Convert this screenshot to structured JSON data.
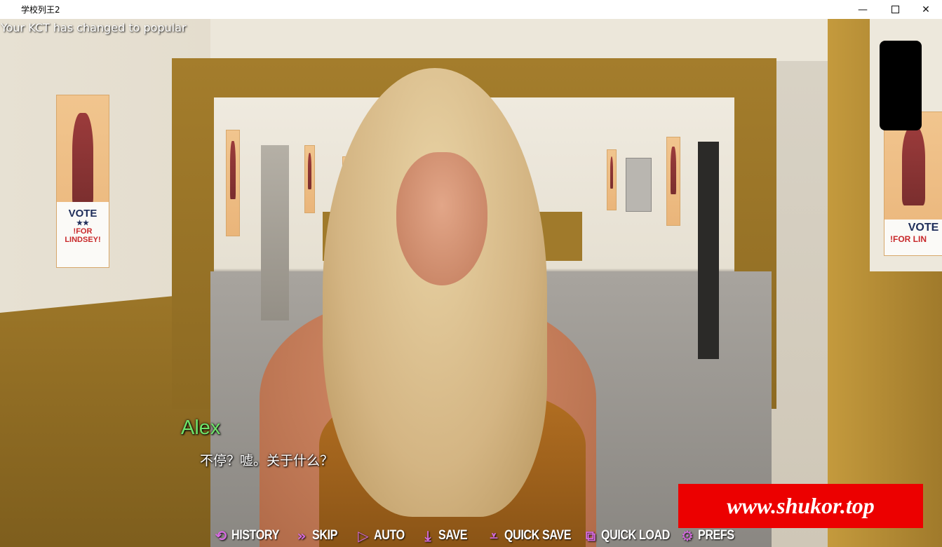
{
  "window": {
    "title": "学校列王2",
    "minimize_glyph": "—",
    "close_glyph": "✕"
  },
  "notification": "Your KCT has changed to popular",
  "posters": {
    "vote_text": "VOTE",
    "stars": "★★",
    "candidate_text": "!FOR LINDSEY!",
    "right_candidate_text": "!FOR LIN"
  },
  "dialogue": {
    "speaker": "Alex",
    "text": "不停？嘘。关于什么？",
    "speaker_color": "#6fe36a"
  },
  "watermark": "www.shukor.top",
  "quick_menu": {
    "icon_color": "#d56be0",
    "items": [
      {
        "label": "HISTORY",
        "icon": "history-icon",
        "glyph": "⟲"
      },
      {
        "label": "SKIP",
        "icon": "skip-icon",
        "glyph": "»"
      },
      {
        "label": "AUTO",
        "icon": "auto-icon",
        "glyph": "▷"
      },
      {
        "label": "SAVE",
        "icon": "save-icon",
        "glyph": "⤓"
      },
      {
        "label": "QUICK SAVE",
        "icon": "quick-save-icon",
        "glyph": "⩡"
      },
      {
        "label": "QUICK LOAD",
        "icon": "quick-load-icon",
        "glyph": "⧉"
      },
      {
        "label": "PREFS",
        "icon": "prefs-icon",
        "glyph": "⚙"
      }
    ]
  }
}
